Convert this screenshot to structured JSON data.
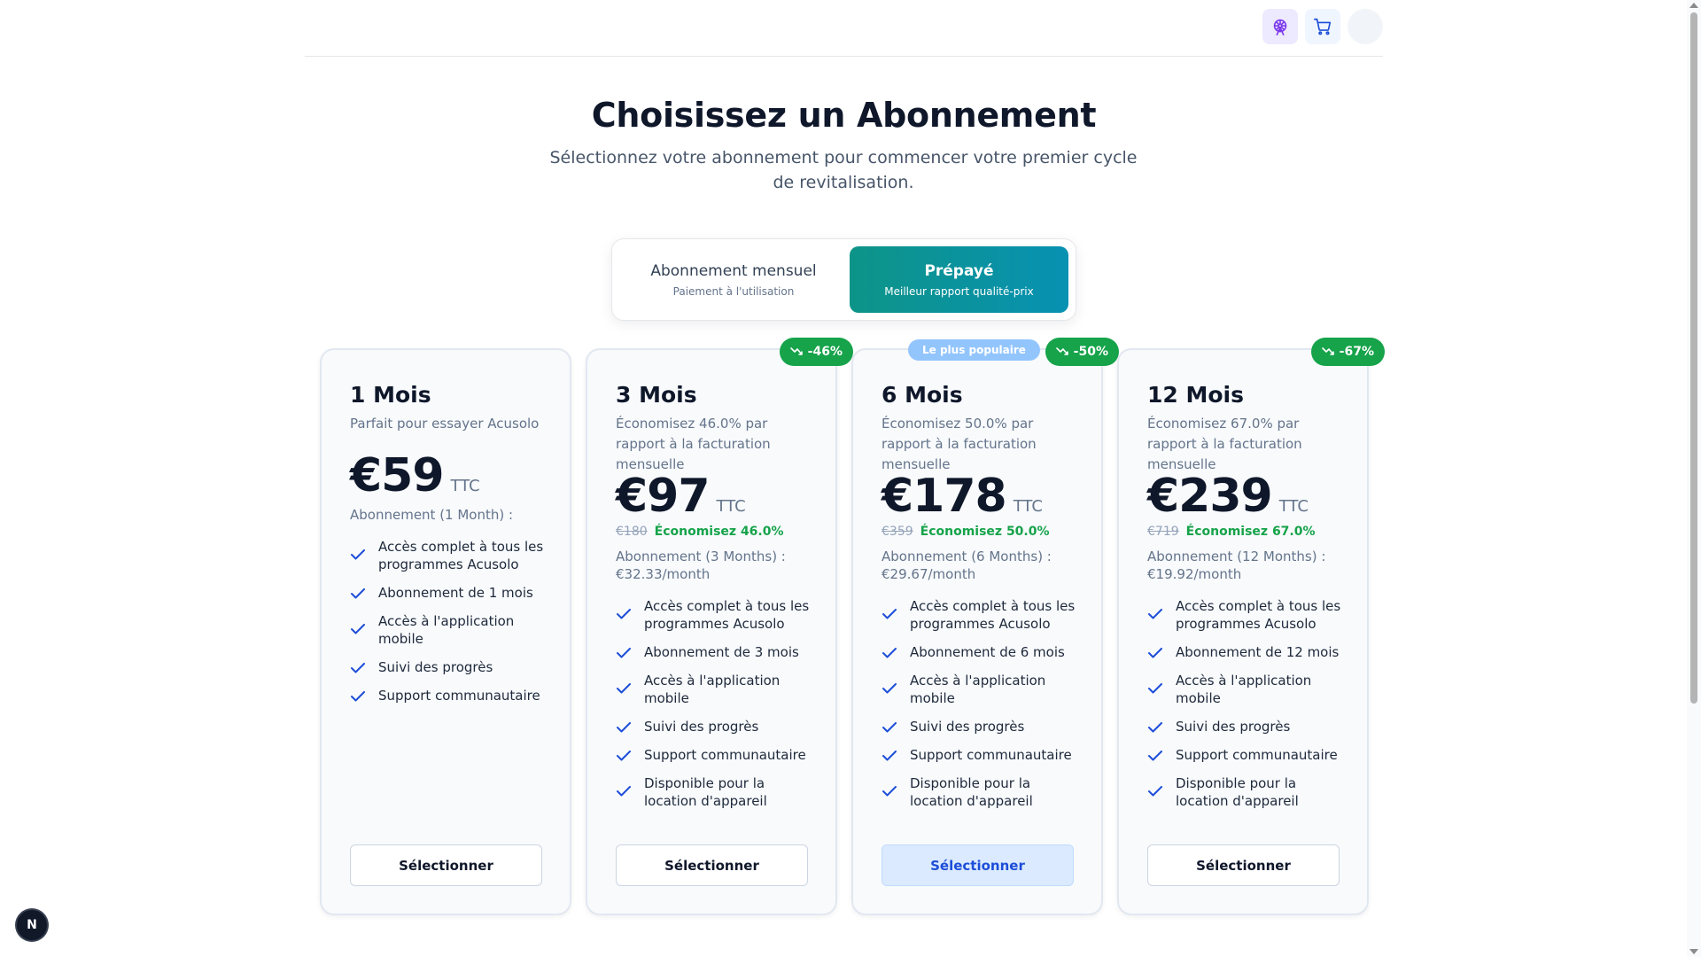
{
  "header": {
    "theme_icon": "ferris-wheel-icon",
    "cart_icon": "cart-icon",
    "accent_colors": {
      "theme_button": "#ede9fe",
      "cart_button": "#eff6ff"
    }
  },
  "hero": {
    "title": "Choisissez un Abonnement",
    "subtitle": "Sélectionnez votre abonnement pour commencer votre premier cycle de revitalisation."
  },
  "billing_toggle": {
    "monthly_title": "Abonnement mensuel",
    "monthly_subtitle": "Paiement à l'utilisation",
    "prepaid_title": "Prépayé",
    "prepaid_subtitle": "Meilleur rapport qualité-prix",
    "selected": "prepaid",
    "selected_color": "#0d9488"
  },
  "plans": [
    {
      "name": "1 Mois",
      "description": "Parfait pour essayer Acusolo",
      "price": "€59",
      "tax_label": "TTC",
      "subscription_line": "Abonnement (1 Month) :",
      "features": [
        "Accès complet à tous les programmes Acusolo",
        "Abonnement de 1 mois",
        "Accès à l'application mobile",
        "Suivi des progrès",
        "Support communautaire"
      ],
      "button_label": "Sélectionner"
    },
    {
      "name": "3 Mois",
      "description": "Économisez 46.0% par rapport à la facturation mensuelle",
      "price": "€97",
      "tax_label": "TTC",
      "old_price": "€180",
      "savings": "Économisez 46.0%",
      "subscription_line": "Abonnement (3 Months) :",
      "per_month": "€32.33/month",
      "discount_badge": "-46%",
      "features": [
        "Accès complet à tous les programmes Acusolo",
        "Abonnement de 3 mois",
        "Accès à l'application mobile",
        "Suivi des progrès",
        "Support communautaire",
        "Disponible pour la location d'appareil"
      ],
      "button_label": "Sélectionner"
    },
    {
      "name": "6 Mois",
      "description": "Économisez 50.0% par rapport à la facturation mensuelle",
      "price": "€178",
      "tax_label": "TTC",
      "old_price": "€359",
      "savings": "Économisez 50.0%",
      "subscription_line": "Abonnement (6 Months) :",
      "per_month": "€29.67/month",
      "discount_badge": "-50%",
      "popular_badge": "Le plus populaire",
      "features": [
        "Accès complet à tous les programmes Acusolo",
        "Abonnement de 6 mois",
        "Accès à l'application mobile",
        "Suivi des progrès",
        "Support communautaire",
        "Disponible pour la location d'appareil"
      ],
      "button_label": "Sélectionner"
    },
    {
      "name": "12 Mois",
      "description": "Économisez 67.0% par rapport à la facturation mensuelle",
      "price": "€239",
      "tax_label": "TTC",
      "old_price": "€719",
      "savings": "Économisez 67.0%",
      "subscription_line": "Abonnement (12 Months) :",
      "per_month": "€19.92/month",
      "discount_badge": "-67%",
      "features": [
        "Accès complet à tous les programmes Acusolo",
        "Abonnement de 12 mois",
        "Accès à l'application mobile",
        "Suivi des progrès",
        "Support communautaire",
        "Disponible pour la location d'appareil"
      ],
      "button_label": "Sélectionner"
    }
  ],
  "colors": {
    "savings_green": "#16a34a",
    "check_blue": "#1d4ed8",
    "popular_blue": "#93c5fd"
  },
  "dev_badge": {
    "label": "N"
  }
}
